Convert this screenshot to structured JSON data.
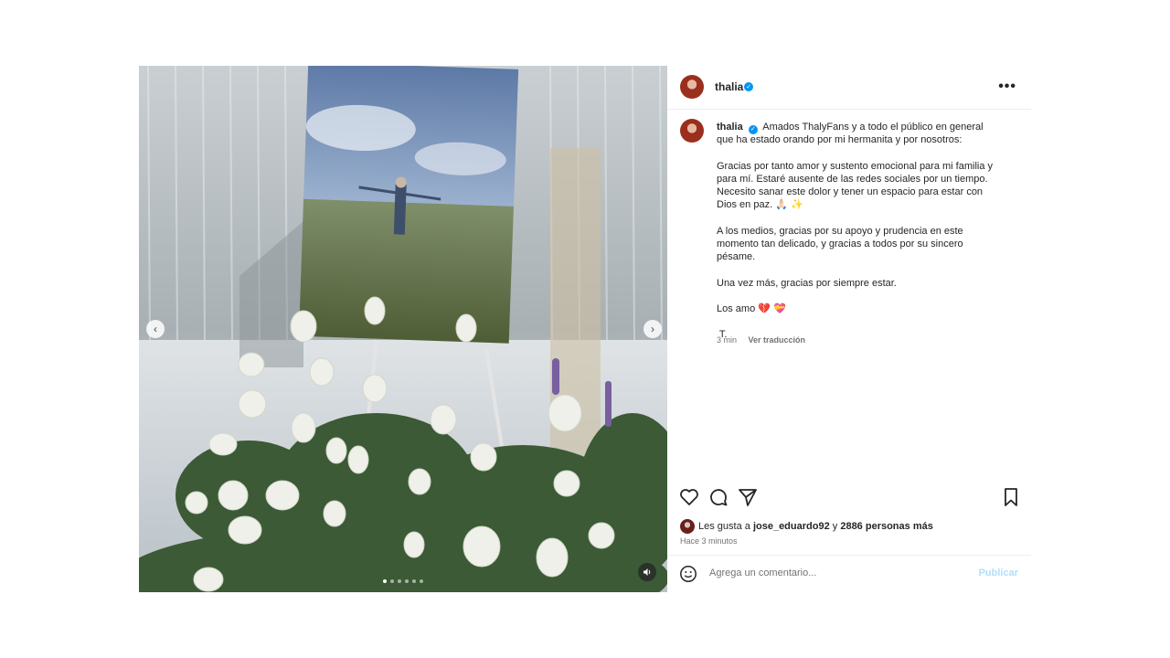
{
  "author": {
    "username": "thalia",
    "verified": true
  },
  "caption": {
    "username": "thalia",
    "lines": [
      "Amados ThalyFans y a todo el público en general que ha estado orando por mi hermanita y por nosotros:",
      "Gracias por tanto amor y sustento emocional para mi familia y para mí. Estaré ausente de las redes sociales por un tiempo. Necesito sanar este dolor y tener un espacio para estar con Dios en paz. 🙏🏻 ✨",
      "A los medios, gracias por su apoyo y prudencia en este momento tan delicado, y gracias a todos por su sincero pésame.",
      "Una vez más, gracias por siempre estar.",
      "Los amo 💔 💝",
      " T."
    ],
    "time": "3 min",
    "see_translation": "Ver traducción"
  },
  "likes": {
    "prefix": "Les gusta a",
    "user": "jose_eduardo92",
    "connector": "y",
    "others": "2886 personas más"
  },
  "posted_ago": "Hace 3 minutos",
  "comment": {
    "placeholder": "Agrega un comentario...",
    "post_label": "Publicar"
  },
  "carousel": {
    "slide_count": 6,
    "active_index": 0
  },
  "icons": {
    "more": "more-options-icon",
    "like": "heart-icon",
    "comment": "comment-icon",
    "share": "share-icon",
    "save": "bookmark-icon",
    "emoji": "emoji-icon",
    "prev": "chevron-left-icon",
    "next": "chevron-right-icon",
    "sound": "sound-on-icon"
  }
}
